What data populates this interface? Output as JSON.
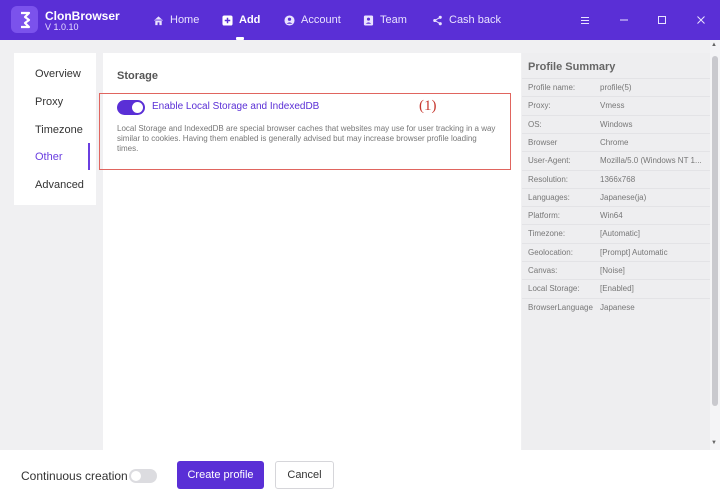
{
  "app": {
    "name": "ClonBrowser",
    "version": "V 1.0.10"
  },
  "nav": [
    {
      "label": "Home",
      "icon": "home-icon"
    },
    {
      "label": "Add",
      "icon": "plus-square-icon",
      "active": true
    },
    {
      "label": "Account",
      "icon": "account-icon"
    },
    {
      "label": "Team",
      "icon": "team-icon"
    },
    {
      "label": "Cash back",
      "icon": "share-icon"
    }
  ],
  "window_controls": [
    "menu-icon",
    "minimize-icon",
    "maximize-icon",
    "close-icon"
  ],
  "subnav": [
    {
      "label": "Overview"
    },
    {
      "label": "Proxy"
    },
    {
      "label": "Timezone"
    },
    {
      "label": "Other",
      "active": true
    },
    {
      "label": "Advanced"
    }
  ],
  "main": {
    "section_title": "Storage",
    "storage_toggle": {
      "label": "Enable Local Storage and IndexedDB",
      "enabled": true
    },
    "annotation": "(1)",
    "description": "Local Storage and IndexedDB are special browser caches that websites may use for user tracking in a way similar to cookies. Having them enabled is generally advised but may increase browser profile loading times."
  },
  "summary": {
    "title": "Profile Summary",
    "rows": [
      {
        "key": "Profile name:",
        "value": "profile(5)"
      },
      {
        "key": "Proxy:",
        "value": "Vmess"
      },
      {
        "key": "OS:",
        "value": "Windows"
      },
      {
        "key": "Browser",
        "value": "Chrome"
      },
      {
        "key": "User-Agent:",
        "value": "Mozilla/5.0 (Windows NT 1..."
      },
      {
        "key": "Resolution:",
        "value": "1366x768"
      },
      {
        "key": "Languages:",
        "value": "Japanese(ja)"
      },
      {
        "key": "Platform:",
        "value": "Win64"
      },
      {
        "key": "Timezone:",
        "value": "[Automatic]"
      },
      {
        "key": "Geolocation:",
        "value": "[Prompt] Automatic"
      },
      {
        "key": "Canvas:",
        "value": "[Noise]"
      },
      {
        "key": "Local Storage:",
        "value": "[Enabled]"
      },
      {
        "key": "BrowserLanguage",
        "value": "Japanese"
      }
    ]
  },
  "footer": {
    "continuous_label": "Continuous creation",
    "continuous_enabled": false,
    "create_label": "Create profile",
    "cancel_label": "Cancel"
  },
  "colors": {
    "accent": "#5a2fd6",
    "annotation": "#c7382f"
  }
}
